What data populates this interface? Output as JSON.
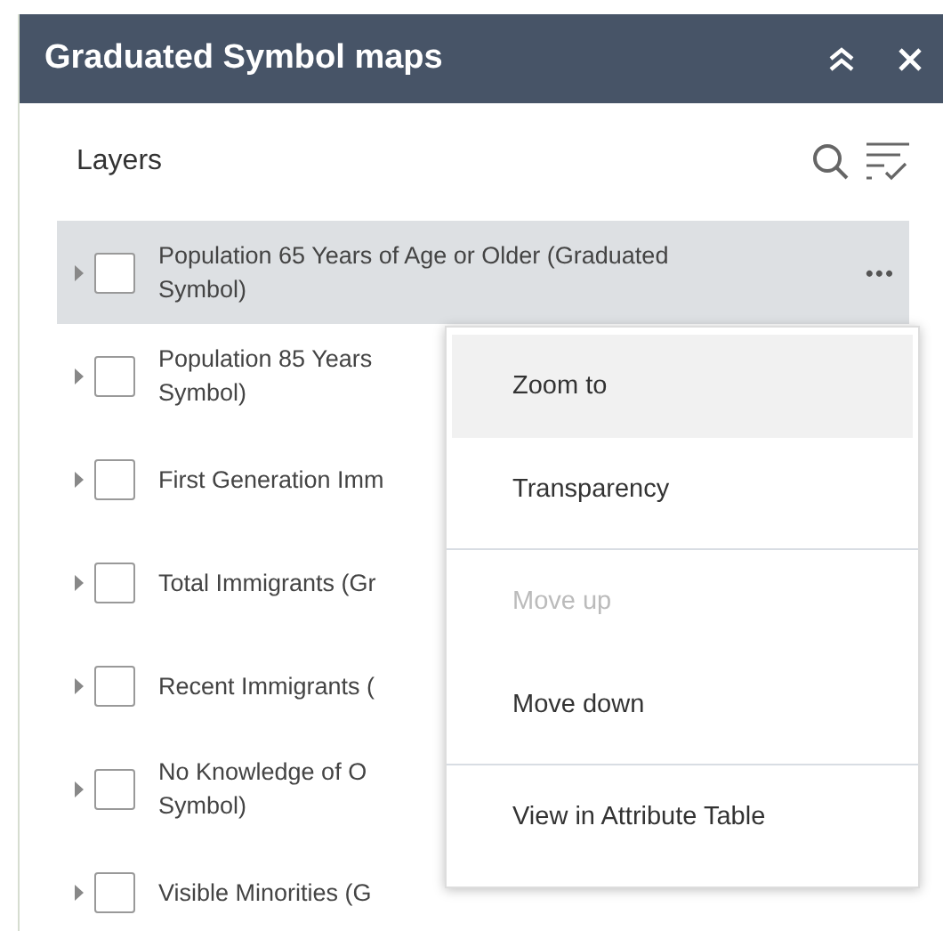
{
  "panel": {
    "title": "Graduated Symbol maps"
  },
  "layers": {
    "heading": "Layers",
    "items": [
      {
        "lines": [
          "Population 65 Years of Age or Older (Graduated",
          "Symbol)"
        ],
        "checked": false,
        "selected": true,
        "more": "•••"
      },
      {
        "lines": [
          "Population 85 Years",
          "Symbol)"
        ],
        "checked": false,
        "selected": false
      },
      {
        "lines": [
          "First Generation Imm"
        ],
        "checked": false,
        "selected": false
      },
      {
        "lines": [
          "Total Immigrants (Gr"
        ],
        "checked": false,
        "selected": false
      },
      {
        "lines": [
          "Recent Immigrants ("
        ],
        "checked": false,
        "selected": false
      },
      {
        "lines": [
          "No Knowledge of O",
          "Symbol)"
        ],
        "checked": false,
        "selected": false
      },
      {
        "lines": [
          "Visible Minorities (G"
        ],
        "checked": false,
        "selected": false
      }
    ]
  },
  "menu": {
    "groups": [
      [
        {
          "label": "Zoom to",
          "selected": true,
          "disabled": false
        },
        {
          "label": "Transparency",
          "selected": false,
          "disabled": false
        }
      ],
      [
        {
          "label": "Move up",
          "selected": false,
          "disabled": true
        },
        {
          "label": "Move down",
          "selected": false,
          "disabled": false
        }
      ],
      [
        {
          "label": "View in Attribute Table",
          "selected": false,
          "disabled": false
        }
      ]
    ]
  }
}
